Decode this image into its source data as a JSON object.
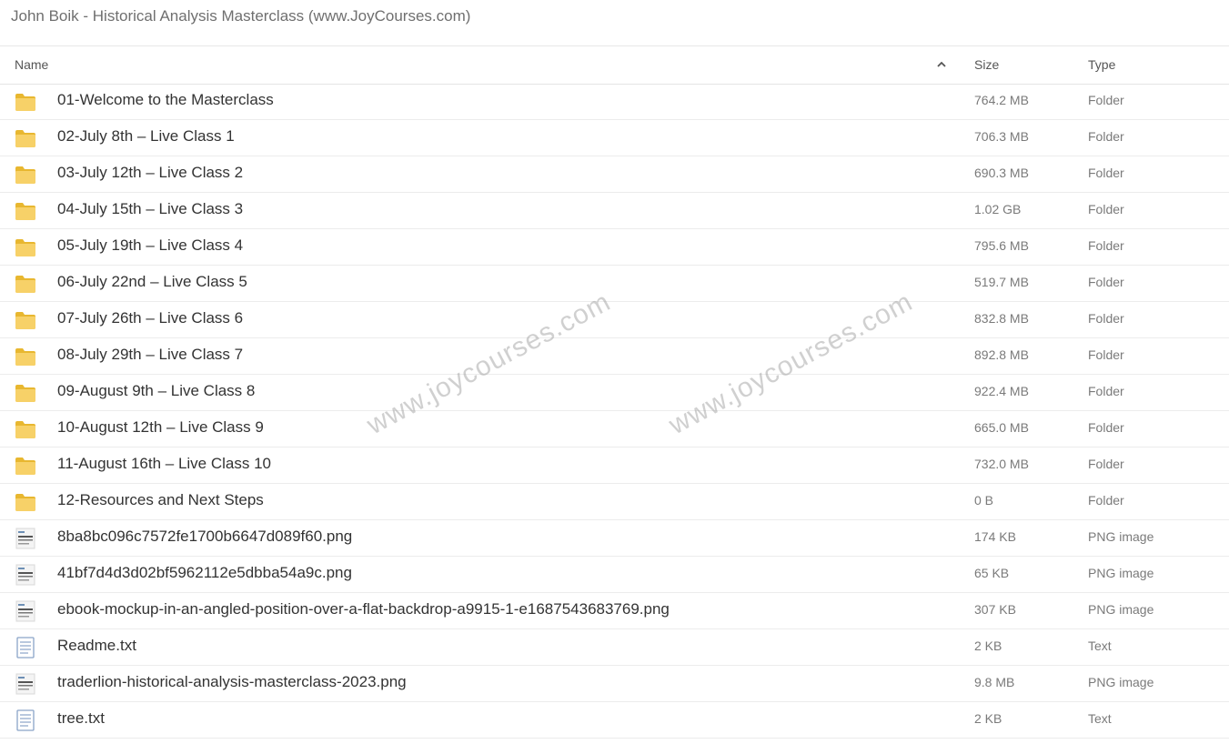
{
  "title": "John Boik - Historical Analysis Masterclass (www.JoyCourses.com)",
  "columns": {
    "name": "Name",
    "size": "Size",
    "type": "Type"
  },
  "sort_icon": "chevron-up-icon",
  "colors": {
    "folder": "#f5c842",
    "folder_dark": "#e8b730"
  },
  "watermark": "www.joycourses.com",
  "files": [
    {
      "name": "01-Welcome to the Masterclass",
      "size": "764.2 MB",
      "type": "Folder",
      "icon": "folder-icon"
    },
    {
      "name": "02-July 8th – Live Class 1",
      "size": "706.3 MB",
      "type": "Folder",
      "icon": "folder-icon"
    },
    {
      "name": "03-July 12th – Live Class 2",
      "size": "690.3 MB",
      "type": "Folder",
      "icon": "folder-icon"
    },
    {
      "name": "04-July 15th – Live Class 3",
      "size": "1.02 GB",
      "type": "Folder",
      "icon": "folder-icon"
    },
    {
      "name": "05-July 19th – Live Class 4",
      "size": "795.6 MB",
      "type": "Folder",
      "icon": "folder-icon"
    },
    {
      "name": "06-July 22nd – Live Class 5",
      "size": "519.7 MB",
      "type": "Folder",
      "icon": "folder-icon"
    },
    {
      "name": "07-July 26th – Live Class 6",
      "size": "832.8 MB",
      "type": "Folder",
      "icon": "folder-icon"
    },
    {
      "name": "08-July 29th – Live Class 7",
      "size": "892.8 MB",
      "type": "Folder",
      "icon": "folder-icon"
    },
    {
      "name": "09-August 9th – Live Class 8",
      "size": "922.4 MB",
      "type": "Folder",
      "icon": "folder-icon"
    },
    {
      "name": "10-August 12th – Live Class 9",
      "size": "665.0 MB",
      "type": "Folder",
      "icon": "folder-icon"
    },
    {
      "name": "11-August 16th – Live Class 10",
      "size": "732.0 MB",
      "type": "Folder",
      "icon": "folder-icon"
    },
    {
      "name": "12-Resources and Next Steps",
      "size": "0 B",
      "type": "Folder",
      "icon": "folder-icon"
    },
    {
      "name": "8ba8bc096c7572fe1700b6647d089f60.png",
      "size": "174 KB",
      "type": "PNG image",
      "icon": "image-thumbnail-icon"
    },
    {
      "name": "41bf7d4d3d02bf5962112e5dbba54a9c.png",
      "size": "65 KB",
      "type": "PNG image",
      "icon": "image-thumbnail-icon"
    },
    {
      "name": "ebook-mockup-in-an-angled-position-over-a-flat-backdrop-a9915-1-e1687543683769.png",
      "size": "307 KB",
      "type": "PNG image",
      "icon": "image-thumbnail-icon"
    },
    {
      "name": "Readme.txt",
      "size": "2 KB",
      "type": "Text",
      "icon": "text-file-icon"
    },
    {
      "name": "traderlion-historical-analysis-masterclass-2023.png",
      "size": "9.8 MB",
      "type": "PNG image",
      "icon": "image-thumbnail-icon"
    },
    {
      "name": "tree.txt",
      "size": "2 KB",
      "type": "Text",
      "icon": "text-file-icon"
    }
  ]
}
